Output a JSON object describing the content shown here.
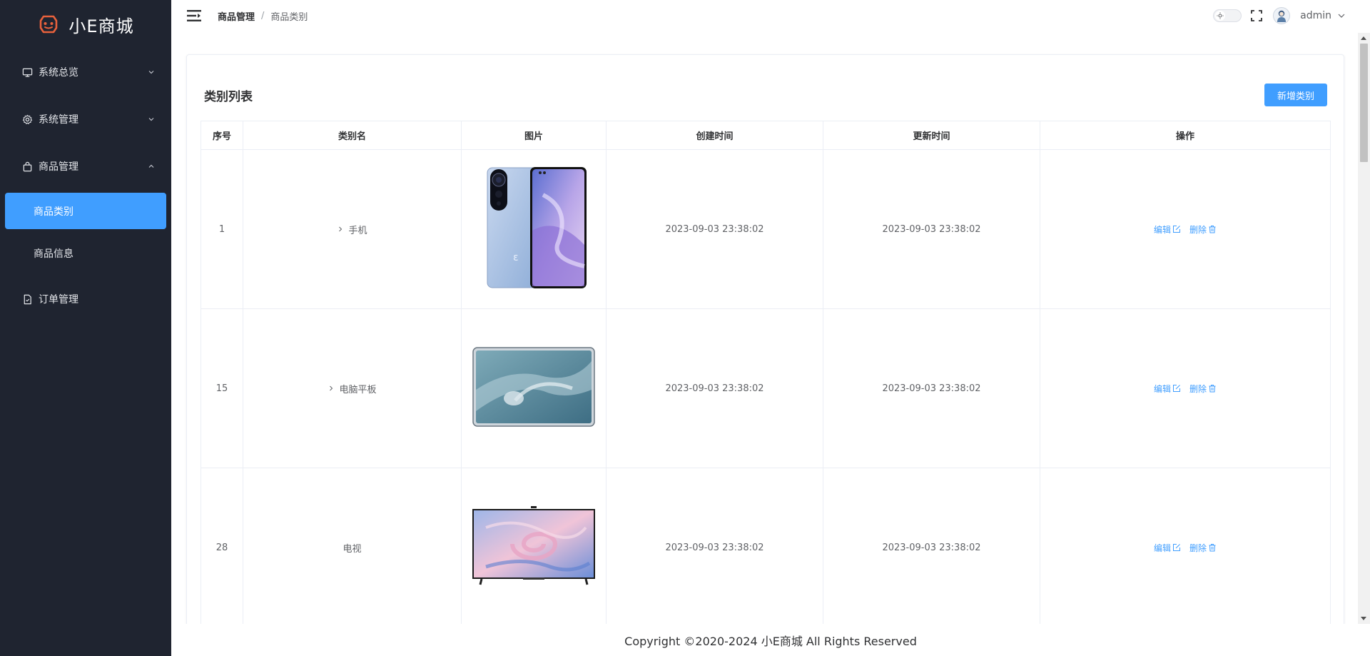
{
  "app": {
    "logo_text": "小E商城"
  },
  "sidebar": {
    "items": [
      {
        "label": "系统总览",
        "icon": "monitor-icon",
        "expanded": false
      },
      {
        "label": "系统管理",
        "icon": "gear-icon",
        "expanded": false
      },
      {
        "label": "商品管理",
        "icon": "shopping-bag-icon",
        "expanded": true,
        "children": [
          {
            "label": "商品类别",
            "active": true
          },
          {
            "label": "商品信息",
            "active": false
          }
        ]
      },
      {
        "label": "订单管理",
        "icon": "document-icon"
      }
    ]
  },
  "header": {
    "breadcrumb": [
      "商品管理",
      "商品类别"
    ],
    "separator": "/",
    "username": "admin"
  },
  "main": {
    "title": "类别列表",
    "add_button_label": "新增类别",
    "columns": [
      "序号",
      "类别名",
      "图片",
      "创建时间",
      "更新时间",
      "操作"
    ],
    "rows": [
      {
        "index": "1",
        "name": "手机",
        "has_children": true,
        "image": "phone-image",
        "created": "2023-09-03 23:38:02",
        "updated": "2023-09-03 23:38:02"
      },
      {
        "index": "15",
        "name": "电脑平板",
        "has_children": true,
        "image": "tablet-image",
        "created": "2023-09-03 23:38:02",
        "updated": "2023-09-03 23:38:02"
      },
      {
        "index": "28",
        "name": "电视",
        "has_children": false,
        "image": "tv-image",
        "created": "2023-09-03 23:38:02",
        "updated": "2023-09-03 23:38:02"
      }
    ],
    "actions": {
      "edit": "编辑",
      "delete": "删除"
    }
  },
  "footer": {
    "copyright": "Copyright ©2020-2024 小E商城 All Rights Reserved"
  },
  "colors": {
    "sidebar_bg": "#1f2430",
    "accent": "#409eff",
    "logo_accent": "#e8613c"
  }
}
